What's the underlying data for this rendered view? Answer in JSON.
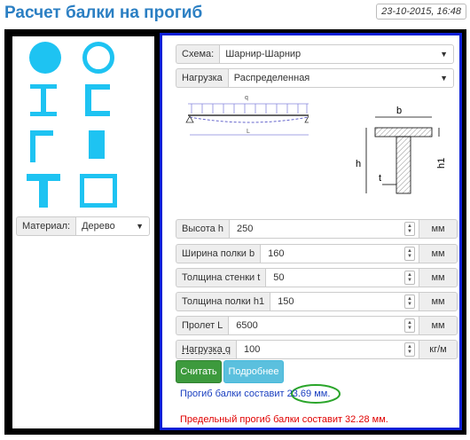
{
  "header": {
    "title": "Расчет балки на прогиб",
    "date": "23-10-2015, 16:48"
  },
  "left": {
    "shapes": [
      "circle-solid",
      "circle-hollow",
      "i-beam",
      "channel",
      "angle",
      "rectangle-solid",
      "t-beam",
      "rectangle-hollow"
    ],
    "material": {
      "label": "Материал:",
      "value": "Дерево"
    }
  },
  "form": {
    "scheme": {
      "label": "Схема:",
      "value": "Шарнир-Шарнир"
    },
    "load_type": {
      "label": "Нагрузка",
      "value": "Распределенная"
    },
    "diagram": {
      "q": "q",
      "L": "L",
      "b": "b",
      "h": "h",
      "t": "t",
      "h1": "h1"
    },
    "fields": [
      {
        "label": "Высота h",
        "value": "250",
        "unit": "мм"
      },
      {
        "label": "Ширина полки b",
        "value": "160",
        "unit": "мм"
      },
      {
        "label": "Толщина стенки t",
        "value": "50",
        "unit": "мм"
      },
      {
        "label": "Толщина полки h1",
        "value": "150",
        "unit": "мм"
      },
      {
        "label": "Пролет L",
        "value": "6500",
        "unit": "мм"
      },
      {
        "label": "Нагрузка q",
        "value": "100",
        "unit": "кг/м"
      }
    ],
    "buttons": {
      "calc": "Считать",
      "more": "Подробнее"
    },
    "result_deflection": "Прогиб балки составит 23.69 мм.",
    "result_limit": "Предельный прогиб балки составит 32.28 мм."
  },
  "colors": {
    "accent": "#2b7fc3",
    "shape": "#1ec3f2",
    "frame": "#0a1fd6",
    "success": "#3d9a3d",
    "info": "#5bc0de",
    "limit": "#e00000",
    "highlight_oval": "#2aa52a"
  }
}
